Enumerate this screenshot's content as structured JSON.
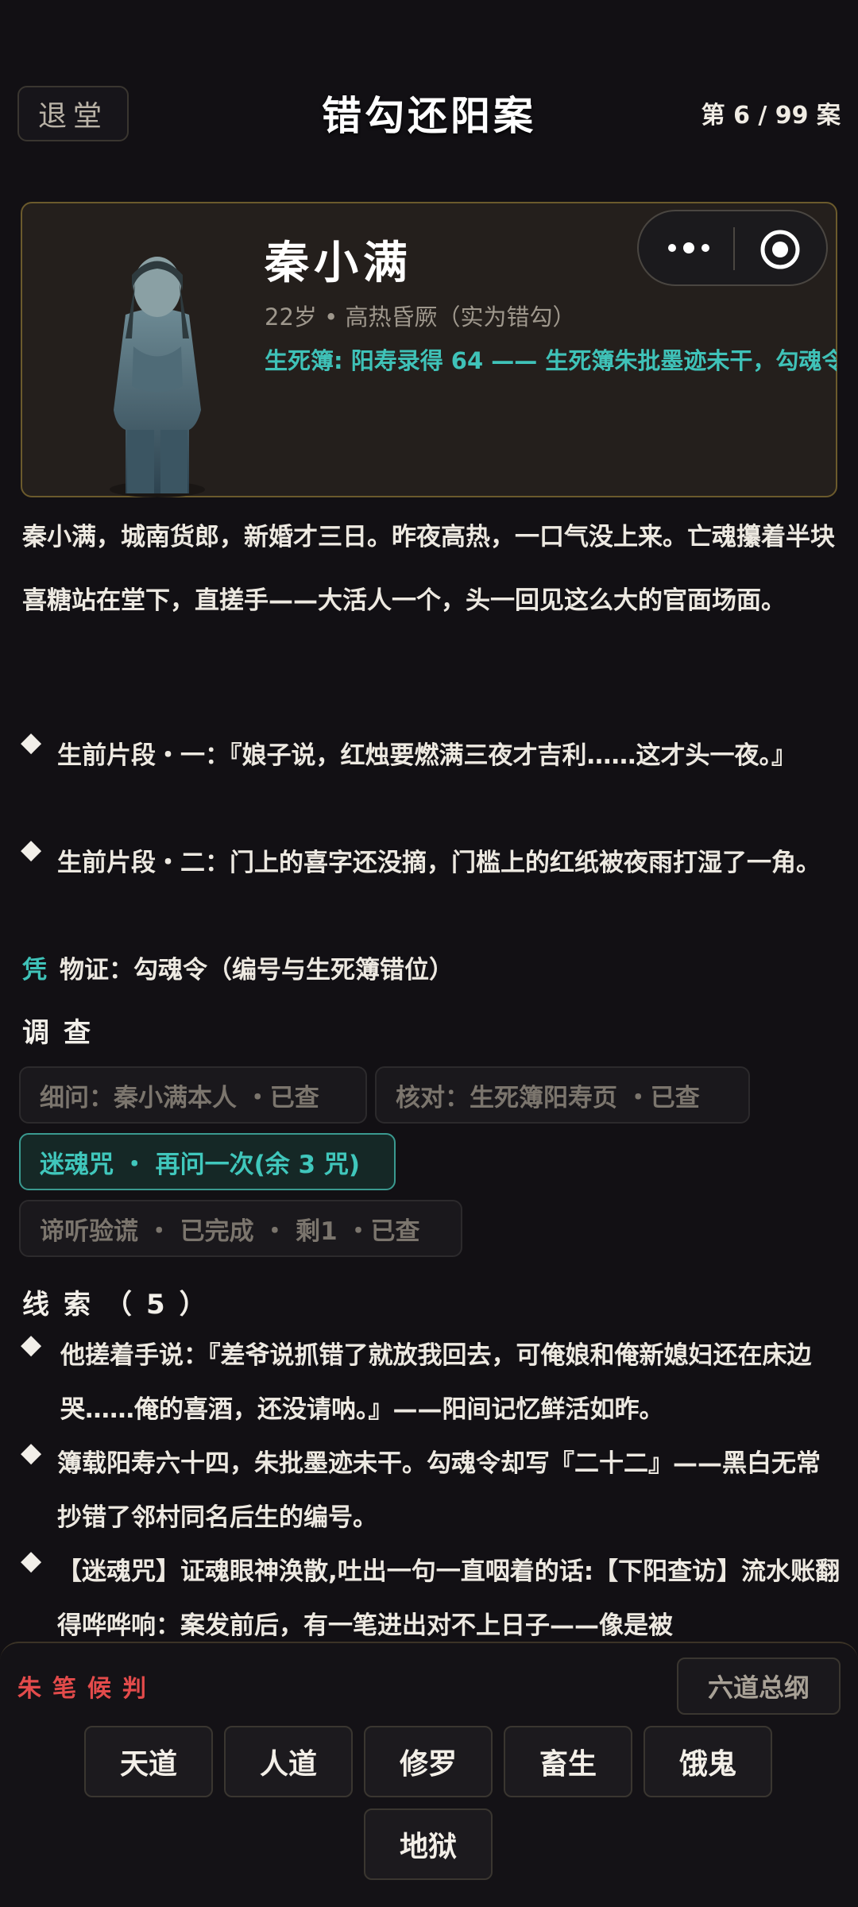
{
  "header": {
    "back_label": "退堂",
    "title": "错勾还阳案",
    "case_counter": "第 6 / 99 案"
  },
  "character": {
    "name": "秦小满",
    "info": "22岁 • 高热昏厥（实为错勾）",
    "life_record": "生死簿: 阳寿录得 64 —— 生死簿朱批墨迹未干，勾魂令"
  },
  "story": {
    "intro": "秦小满，城南货郎，新婚才三日。昨夜高热，一口气没上来。亡魂攥着半块喜糖站在堂下，直搓手——大活人一个，头一回见这么大的官面场面。",
    "fragments": [
      "生前片段・一：『娘子说，红烛要燃满三夜才吉利……这才头一夜。』",
      "生前片段・二：门上的喜字还没摘，门槛上的红纸被夜雨打湿了一角。"
    ],
    "evidence_mark": "凭",
    "evidence": "物证：勾魂令（编号与生死簿错位）"
  },
  "investigate": {
    "title": "调查",
    "actions": [
      {
        "label": "细问：秦小满本人 ・已查"
      },
      {
        "label": "核对：生死簿阳寿页 ・已查"
      },
      {
        "label": "迷魂咒 ・ 再问一次(余 3 咒)"
      },
      {
        "label": "谛听验谎 ・ 已完成 ・ 剩1 ・已查"
      }
    ]
  },
  "clues": {
    "title": "线索（5）",
    "items": [
      "他搓着手说：『差爷说抓错了就放我回去，可俺娘和俺新媳妇还在床边哭……俺的喜酒，还没请呐。』——阳间记忆鲜活如昨。",
      "簿载阳寿六十四，朱批墨迹未干。勾魂令却写『二十二』——黑白无常抄错了邻村同名后生的编号。",
      "【迷魂咒】证魂眼神涣散,吐出一句一直咽着的话:【下阳查访】流水账翻得哗哗响：案发前后，有一笔进出对不上日子——像是被"
    ]
  },
  "verdict": {
    "label": "朱笔候判",
    "overview_label": "六道总纲",
    "realms": [
      "天道",
      "人道",
      "修罗",
      "畜生",
      "饿鬼",
      "地狱"
    ]
  },
  "colors": {
    "accent_teal": "#3fc2b8",
    "verdict_red": "#e34b4b",
    "card_border_gold": "#6b5a2c"
  },
  "icons": {
    "more": "more-dots-icon",
    "close": "target-circle-icon"
  }
}
